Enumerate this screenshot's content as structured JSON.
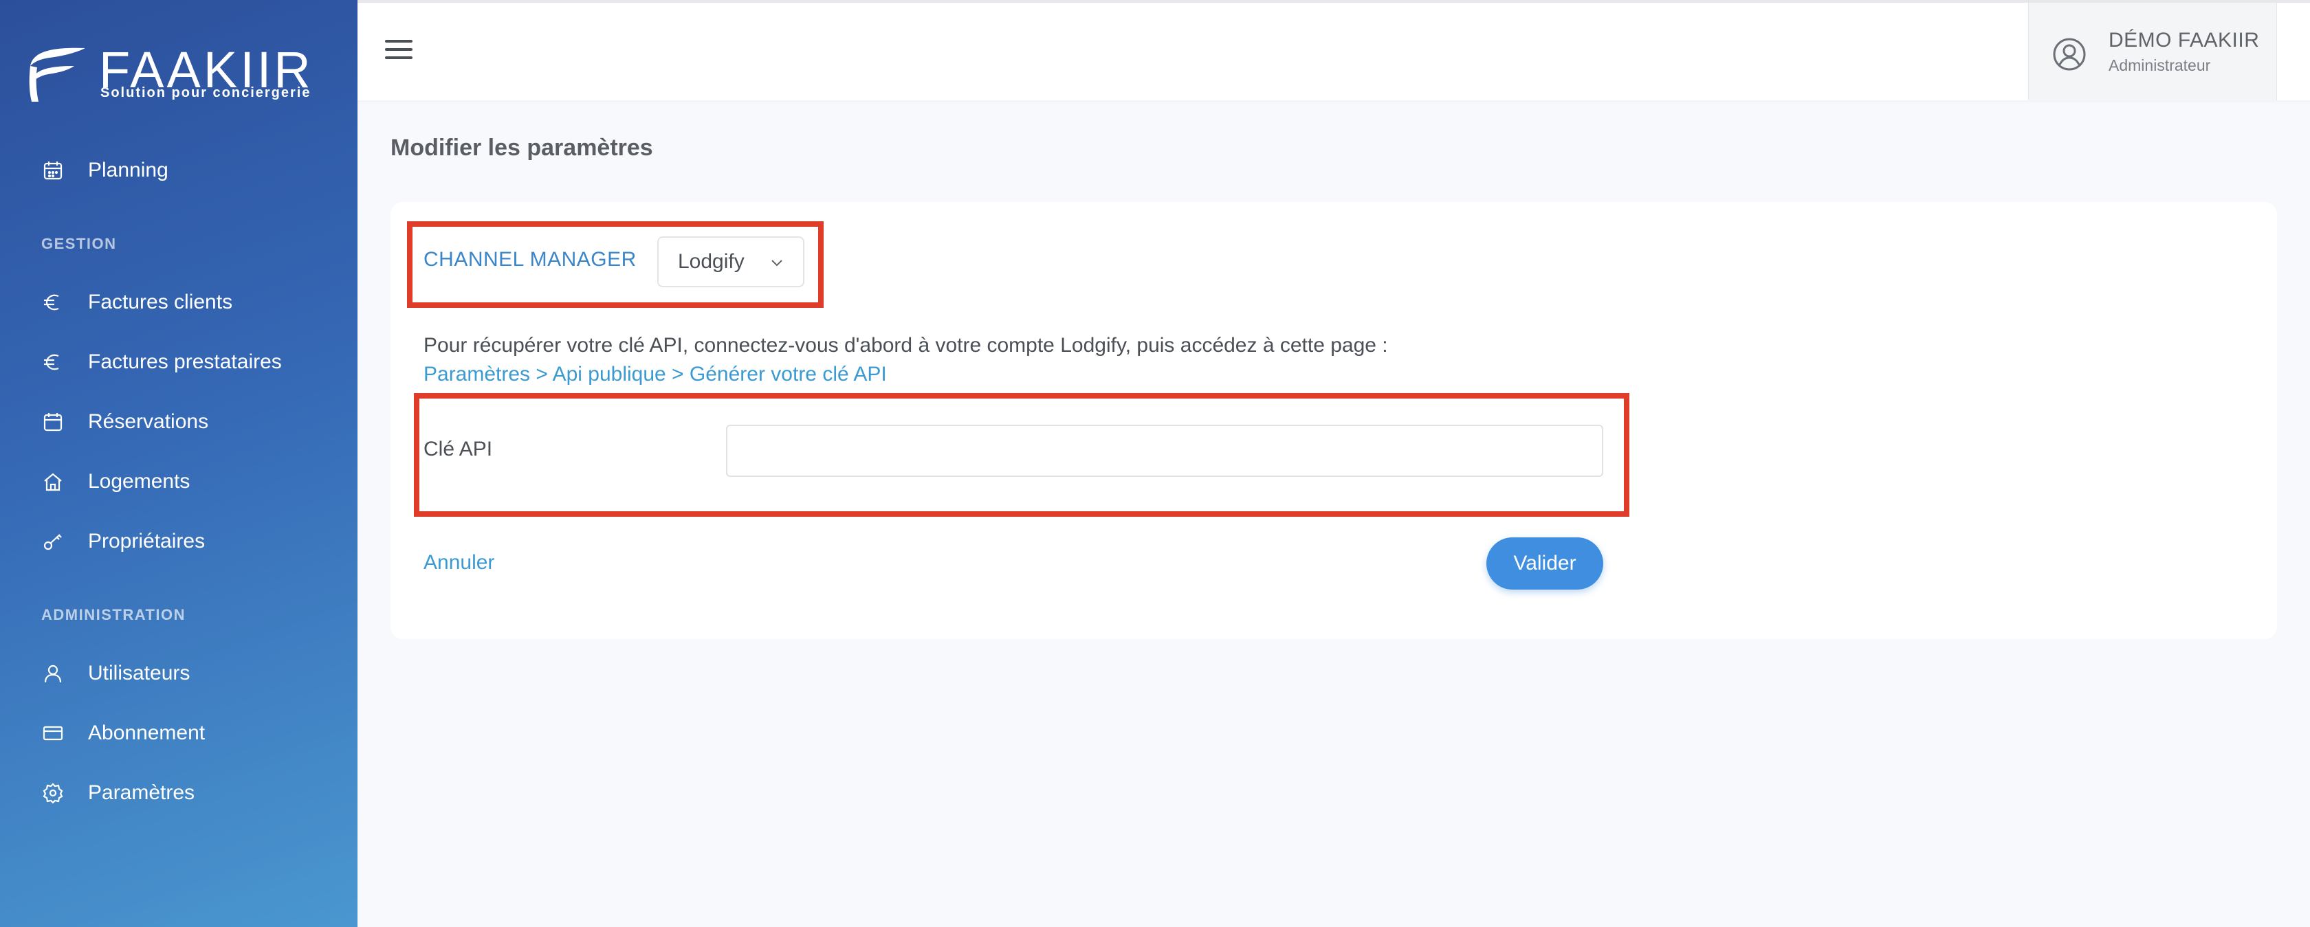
{
  "sidebar": {
    "logo": {
      "brand": "FAAKIIR",
      "tagline": "Solution pour conciergerie"
    },
    "top_items": [
      {
        "label": "Planning",
        "icon": "calendar-icon"
      }
    ],
    "sections": [
      {
        "label": "GESTION",
        "items": [
          {
            "label": "Factures clients",
            "icon": "euro-icon"
          },
          {
            "label": "Factures prestataires",
            "icon": "euro-icon"
          },
          {
            "label": "Réservations",
            "icon": "calendar-icon"
          },
          {
            "label": "Logements",
            "icon": "home-icon"
          },
          {
            "label": "Propriétaires",
            "icon": "key-icon"
          }
        ]
      },
      {
        "label": "ADMINISTRATION",
        "items": [
          {
            "label": "Utilisateurs",
            "icon": "user-icon"
          },
          {
            "label": "Abonnement",
            "icon": "credit-card-icon"
          },
          {
            "label": "Paramètres",
            "icon": "gear-icon"
          }
        ]
      }
    ]
  },
  "topbar": {
    "user": {
      "name": "DÉMO FAAKIIR",
      "role": "Administrateur"
    }
  },
  "main": {
    "title": "Modifier les paramètres",
    "channel_manager": {
      "label": "CHANNEL MANAGER",
      "selected": "Lodgify"
    },
    "help": {
      "text": "Pour récupérer votre clé API, connectez-vous d'abord à votre compte Lodgify, puis accédez à cette page :",
      "link": "Paramètres > Api publique > Générer votre clé API"
    },
    "api_key": {
      "label": "Clé API",
      "value": "",
      "placeholder": ""
    },
    "actions": {
      "cancel": "Annuler",
      "submit": "Valider"
    }
  },
  "colors": {
    "sidebar_top": "#2c4f9b",
    "sidebar_bottom": "#4a97d0",
    "accent": "#3f8ee0",
    "link": "#3a9ad1",
    "highlight": "#e03c2a"
  }
}
